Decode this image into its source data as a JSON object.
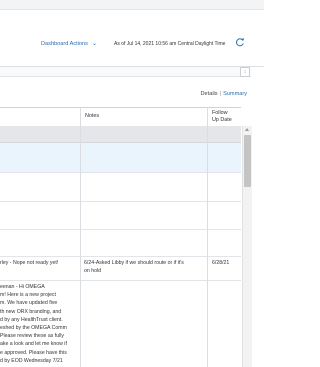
{
  "header": {
    "dashboard_actions": "Dashboard Actions",
    "as_of": "As of Jul 14, 2021 10:56 am Central Daylight Time",
    "refresh_icon": "refresh-icon"
  },
  "view_links": {
    "details": "Details",
    "separator": "|",
    "summary": "Summary"
  },
  "table": {
    "columns": {
      "notes": "Notes",
      "follow_up_line1": "Follow",
      "follow_up_line2": "Up Date"
    },
    "rows": [
      {
        "left_text": "rley - Nope not ready yet!",
        "notes": [
          "6/24-Asked Libby if we should route or if it's",
          "on hold"
        ],
        "follow_up": "6/28/21"
      },
      {
        "left_text": [
          "eenan - Hi OMEGA",
          "m! Here is a new project",
          "m. We have updated five",
          "th new ORX branding, and",
          "d by any HealthTrust client.",
          "eshed by the OMEGA Comm",
          "Please review these as fully",
          "ake a look and let me know if",
          "e approved. Please have this",
          "d by EOD Wednesday 7/21"
        ]
      }
    ]
  }
}
